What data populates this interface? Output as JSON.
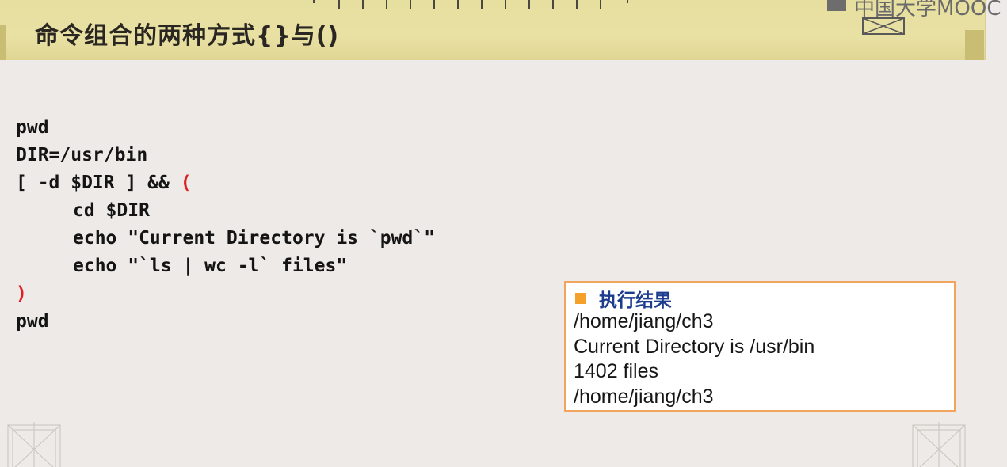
{
  "slide": {
    "title": "命令组合的两种方式{}与()",
    "logo_text": "中国大学MOOC"
  },
  "code": {
    "lines": [
      {
        "text": "pwd",
        "indent": false
      },
      {
        "text": "DIR=/usr/bin",
        "indent": false
      },
      {
        "pre": "[ -d $DIR ] && ",
        "paren": "(",
        "indent": false
      },
      {
        "text": "cd $DIR",
        "indent": true
      },
      {
        "text": "echo \"Current Directory is `pwd`\"",
        "indent": true
      },
      {
        "text": "echo \"`ls | wc -l` files\"",
        "indent": true
      },
      {
        "paren": ")",
        "indent": false
      },
      {
        "text": "pwd",
        "indent": false
      }
    ],
    "paren_color": "#e02020"
  },
  "result": {
    "title": "执行结果",
    "lines": [
      "/home/jiang/ch3",
      "Current Directory is /usr/bin",
      "1402 files",
      "/home/jiang/ch3"
    ],
    "border_color": "#f2a55d",
    "title_color": "#1d3c8e",
    "bullet_color": "#f5a02a"
  },
  "icons": {
    "bullet": "square-bullet-icon",
    "logo": "mooc-logo-icon",
    "corner": "corner-ornament-icon"
  }
}
